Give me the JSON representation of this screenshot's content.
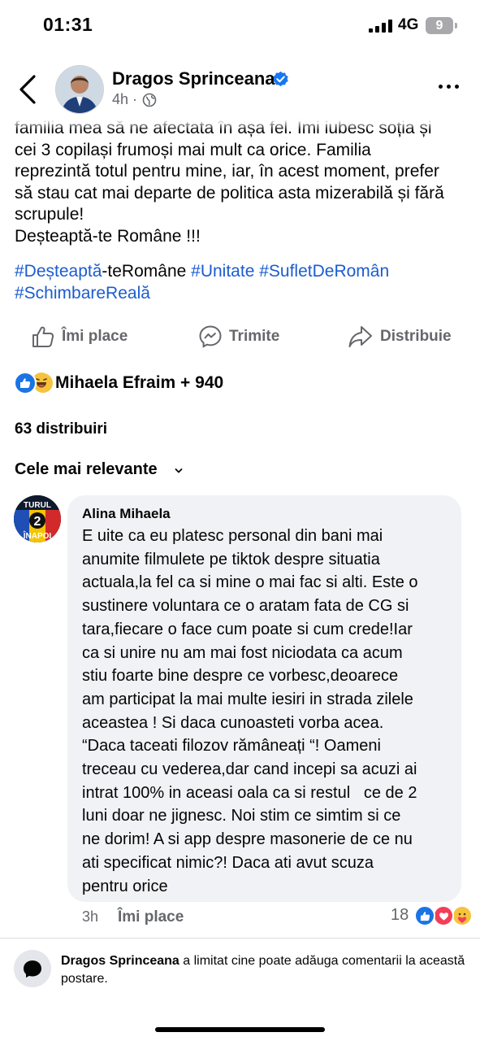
{
  "status_bar": {
    "time": "01:31",
    "network": "4G",
    "battery": "9"
  },
  "header": {
    "page_name": "Dragos Sprinceana",
    "timestamp": "4h",
    "separator": "·",
    "icons": [
      "back-arrow-icon",
      "verified-badge-icon",
      "globe-icon",
      "more-icon"
    ]
  },
  "post": {
    "body_lines": [
      "familia mea să ne afectata în așa fel. Îmi iubesc soția și",
      "cei 3 copilași frumoși mai mult ca orice. Familia",
      "reprezintă totul pentru mine, iar, în acest moment, prefer",
      "să stau cat mai departe de politica asta mizerabilă și fără",
      "scrupule!",
      "Deșteaptă-te Române !!!"
    ],
    "hashtags": {
      "h1_tag": "#Deșteaptă",
      "h1_rest": "-teRomâne",
      "h2": "#Unitate",
      "h3": "#SufletDeRomân",
      "h4": "#SchimbareReală"
    }
  },
  "actions": {
    "like": "Îmi place",
    "send": "Trimite",
    "share": "Distribuie"
  },
  "reactions": {
    "text": "Mihaela Efraim + 940",
    "types": [
      "like",
      "haha"
    ]
  },
  "shares": "63 distribuiri",
  "sort": {
    "label": "Cele mai relevante"
  },
  "comment": {
    "avatar_text": {
      "top": "TURUL",
      "number": "2",
      "bottom": "ÎNAPOI"
    },
    "author": "Alina Mihaela",
    "lines": [
      "E uite ca eu platesc personal din bani mai",
      "anumite filmulete pe tiktok despre situatia",
      "actuala,la fel ca si mine o mai fac si alti. Este o",
      "sustinere voluntara ce o aratam fata de CG si",
      "tara,fiecare o face cum poate si cum crede!Iar",
      "ca si unire nu am mai fost niciodata ca acum",
      "stiu foarte bine despre ce vorbesc,deoarece",
      "am participat la mai multe iesiri in strada zilele",
      "aceastea ! Si daca cunoasteti vorba acea.",
      "“Daca taceati filozov rămâneați “! Oameni",
      "treceau cu vederea,dar cand incepi sa acuzi ai",
      "intrat 100% in aceasi oala ca si restul   ce de 2",
      "luni doar ne jignesc. Noi stim ce simtim si ce",
      "ne dorim! A si app despre masonerie de ce nu",
      "ati specificat nimic?! Daca ati avut scuza",
      "pentru orice"
    ],
    "time": "3h",
    "like_label": "Îmi place",
    "reaction_count": "18",
    "reaction_types": [
      "like",
      "love",
      "care"
    ]
  },
  "notice": {
    "name": "Dragos Sprinceana",
    "text": " a limitat cine poate adăuga comentarii la această postare."
  },
  "colors": {
    "link": "#1b5ccf",
    "like_blue": "#1b74e4",
    "love_red": "#f33e58",
    "muted": "#65676b"
  }
}
